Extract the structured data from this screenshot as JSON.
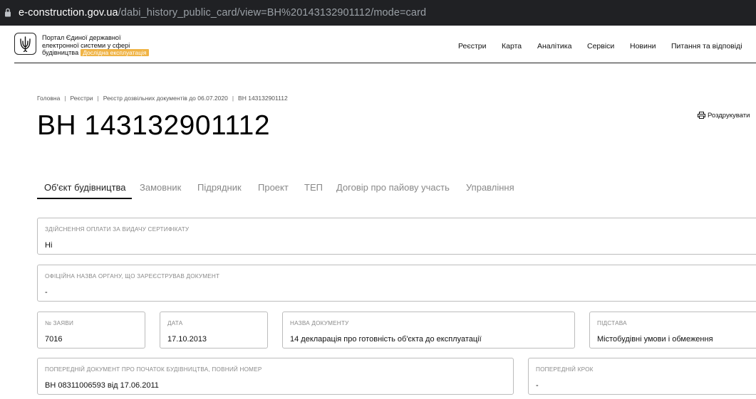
{
  "browser": {
    "url_host": "e-construction.gov.ua",
    "url_path": "/dabi_history_public_card/view=ВН%20143132901112/mode=card"
  },
  "header": {
    "portal_line1": "Портал Єдиної державної",
    "portal_line2": "електронної системи у сфері",
    "portal_line3": "будівництва",
    "badge": "Дослідна експлуатація",
    "nav": [
      "Реєстри",
      "Карта",
      "Аналітика",
      "Сервіси",
      "Новини",
      "Питання та відповіді"
    ]
  },
  "breadcrumb": [
    "Головна",
    "Реєстри",
    "Реєстр дозвільних документів до 06.07.2020",
    "ВН 143132901112"
  ],
  "page_title": "ВН 143132901112",
  "print_label": "Роздрукувати",
  "tabs": [
    "Об'єкт будівництва",
    "Замовник",
    "Підрядник",
    "Проект",
    "ТЕП",
    "Договір про пайову участь",
    "Управління"
  ],
  "fields": {
    "payment": {
      "label": "Здійснення оплати за видачу сертифікату",
      "value": "Ні"
    },
    "authority": {
      "label": "Офіційна назва органу, що зареєстрував документ",
      "value": "-"
    },
    "app_no": {
      "label": "№ заяви",
      "value": "7016"
    },
    "date": {
      "label": "Дата",
      "value": "17.10.2013"
    },
    "doc_name": {
      "label": "Назва документу",
      "value": "14 декларація про готовність об'єкта до експлуатації"
    },
    "basis": {
      "label": "Підстава",
      "value": "Містобудівні умови і обмеження"
    },
    "prev_doc": {
      "label": "Попередній документ про початок будівництва, повний номер",
      "value": "ВН 08311006593 від 17.06.2011"
    },
    "prev_step": {
      "label": "Попередній крок",
      "value": "-"
    }
  }
}
